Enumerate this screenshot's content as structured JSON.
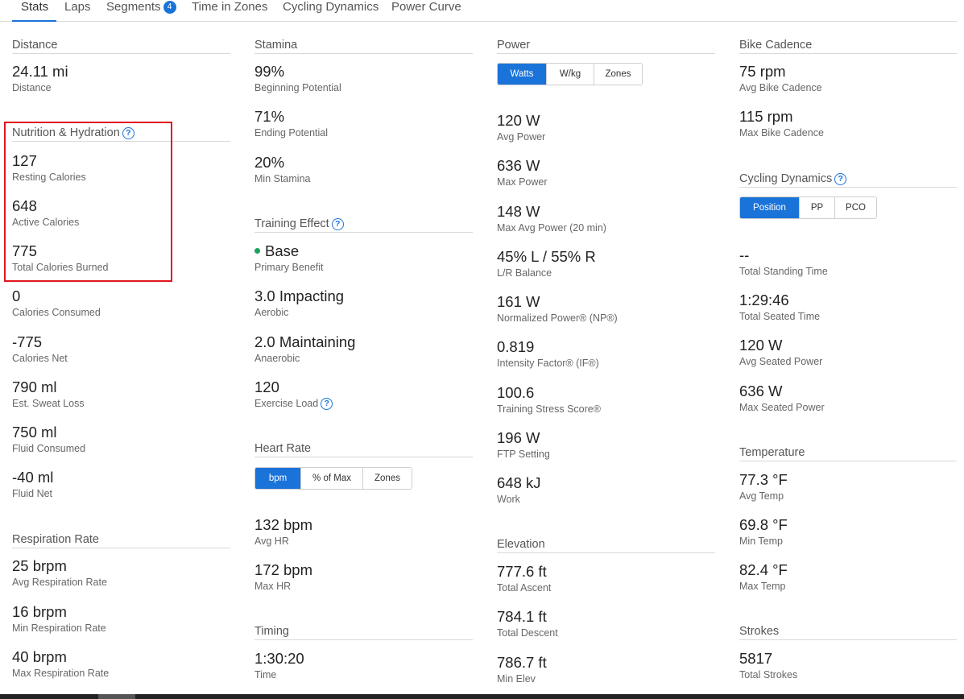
{
  "tabs": [
    {
      "label": "Stats",
      "active": true
    },
    {
      "label": "Laps"
    },
    {
      "label": "Segments",
      "badge": "4"
    },
    {
      "label": "Time in Zones"
    },
    {
      "label": "Cycling Dynamics"
    },
    {
      "label": "Power Curve"
    }
  ],
  "distance": {
    "title": "Distance",
    "stats": [
      {
        "value": "24.11 mi",
        "label": "Distance"
      }
    ]
  },
  "nutrition": {
    "title": "Nutrition & Hydration",
    "stats": [
      {
        "value": "127",
        "label": "Resting Calories"
      },
      {
        "value": "648",
        "label": "Active Calories"
      },
      {
        "value": "775",
        "label": "Total Calories Burned"
      },
      {
        "value": "0",
        "label": "Calories Consumed"
      },
      {
        "value": "-775",
        "label": "Calories Net"
      },
      {
        "value": "790 ml",
        "label": "Est. Sweat Loss"
      },
      {
        "value": "750 ml",
        "label": "Fluid Consumed"
      },
      {
        "value": "-40 ml",
        "label": "Fluid Net"
      }
    ]
  },
  "respiration": {
    "title": "Respiration Rate",
    "stats": [
      {
        "value": "25 brpm",
        "label": "Avg Respiration Rate"
      },
      {
        "value": "16 brpm",
        "label": "Min Respiration Rate"
      },
      {
        "value": "40 brpm",
        "label": "Max Respiration Rate"
      }
    ]
  },
  "stamina": {
    "title": "Stamina",
    "stats": [
      {
        "value": "99%",
        "label": "Beginning Potential"
      },
      {
        "value": "71%",
        "label": "Ending Potential"
      },
      {
        "value": "20%",
        "label": "Min Stamina"
      }
    ]
  },
  "training_effect": {
    "title": "Training Effect",
    "stats": [
      {
        "value": "Base",
        "label": "Primary Benefit"
      },
      {
        "value": "3.0 Impacting",
        "label": "Aerobic"
      },
      {
        "value": "2.0 Maintaining",
        "label": "Anaerobic"
      },
      {
        "value": "120",
        "label": "Exercise Load"
      }
    ]
  },
  "heart_rate": {
    "title": "Heart Rate",
    "buttons": [
      "bpm",
      "% of Max",
      "Zones"
    ],
    "stats": [
      {
        "value": "132 bpm",
        "label": "Avg HR"
      },
      {
        "value": "172 bpm",
        "label": "Max HR"
      }
    ]
  },
  "timing": {
    "title": "Timing",
    "stats": [
      {
        "value": "1:30:20",
        "label": "Time"
      }
    ]
  },
  "power": {
    "title": "Power",
    "buttons": [
      "Watts",
      "W/kg",
      "Zones"
    ],
    "stats": [
      {
        "value": "120 W",
        "label": "Avg Power"
      },
      {
        "value": "636 W",
        "label": "Max Power"
      },
      {
        "value": "148 W",
        "label": "Max Avg Power (20 min)"
      },
      {
        "value": "45% L / 55% R",
        "label": "L/R Balance"
      },
      {
        "value": "161 W",
        "label": "Normalized Power® (NP®)"
      },
      {
        "value": "0.819",
        "label": "Intensity Factor® (IF®)"
      },
      {
        "value": "100.6",
        "label": "Training Stress Score®"
      },
      {
        "value": "196 W",
        "label": "FTP Setting"
      },
      {
        "value": "648 kJ",
        "label": "Work"
      }
    ]
  },
  "elevation": {
    "title": "Elevation",
    "stats": [
      {
        "value": "777.6 ft",
        "label": "Total Ascent"
      },
      {
        "value": "784.1 ft",
        "label": "Total Descent"
      },
      {
        "value": "786.7 ft",
        "label": "Min Elev"
      }
    ]
  },
  "cadence": {
    "title": "Bike Cadence",
    "stats": [
      {
        "value": "75 rpm",
        "label": "Avg Bike Cadence"
      },
      {
        "value": "115 rpm",
        "label": "Max Bike Cadence"
      }
    ]
  },
  "cycling_dynamics": {
    "title": "Cycling Dynamics",
    "buttons": [
      "Position",
      "PP",
      "PCO"
    ],
    "stats": [
      {
        "value": "--",
        "label": "Total Standing Time"
      },
      {
        "value": "1:29:46",
        "label": "Total Seated Time"
      },
      {
        "value": "120 W",
        "label": "Avg Seated Power"
      },
      {
        "value": "636 W",
        "label": "Max Seated Power"
      }
    ]
  },
  "temperature": {
    "title": "Temperature",
    "stats": [
      {
        "value": "77.3 °F",
        "label": "Avg Temp"
      },
      {
        "value": "69.8 °F",
        "label": "Min Temp"
      },
      {
        "value": "82.4 °F",
        "label": "Max Temp"
      }
    ]
  },
  "strokes": {
    "title": "Strokes",
    "stats": [
      {
        "value": "5817",
        "label": "Total Strokes"
      }
    ]
  },
  "colors": {
    "accent": "#1a73d9",
    "highlight": "#e0161e",
    "training_dot": "#1aa15c"
  },
  "icons": {
    "help": "question-circle-icon",
    "bullet": "green-dot-icon"
  },
  "help_glyph": "?"
}
